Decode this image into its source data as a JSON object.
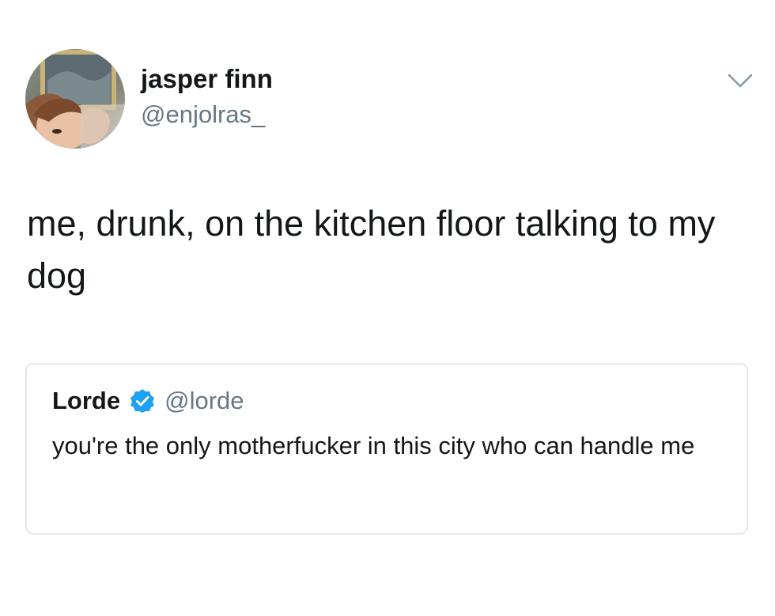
{
  "tweet": {
    "author_name": "jasper finn",
    "author_handle": "@enjolras_",
    "avatar_icon": "profile-photo",
    "menu_icon": "chevron-down-icon",
    "text": "me, drunk, on the kitchen floor talking to my dog"
  },
  "quoted_tweet": {
    "author_name": "Lorde",
    "verified_icon": "verified-badge-icon",
    "author_handle": "@lorde",
    "text": "you're the only motherfucker in this city who can handle me"
  },
  "colors": {
    "primary_text": "#14171a",
    "secondary_text": "#657786",
    "border": "#e1e8ed",
    "verified_blue": "#1da1f2"
  }
}
